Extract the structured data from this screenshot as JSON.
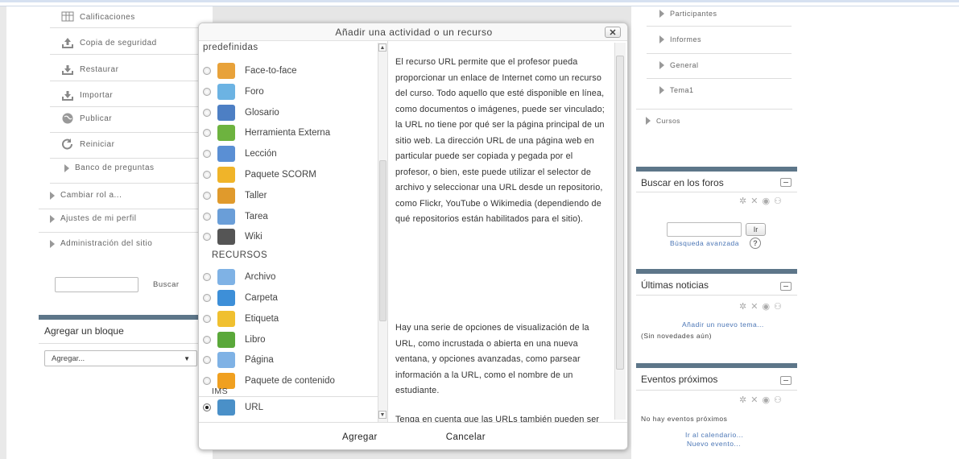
{
  "left_nav": {
    "items": [
      {
        "label": "Calificaciones",
        "icon": "grades-icon"
      },
      {
        "label": "Copia de seguridad",
        "icon": "backup-icon"
      },
      {
        "label": "Restaurar",
        "icon": "restore-icon"
      },
      {
        "label": "Importar",
        "icon": "import-icon"
      },
      {
        "label": "Publicar",
        "icon": "publish-icon"
      },
      {
        "label": "Reiniciar",
        "icon": "reset-icon"
      },
      {
        "label": "Banco de preguntas",
        "icon": "expand-icon"
      }
    ],
    "sections": [
      "Cambiar rol a...",
      "Ajustes de mi perfil",
      "Administración del sitio"
    ],
    "search_button": "Buscar",
    "add_block": {
      "title": "Agregar un bloque",
      "select_value": "Agregar..."
    }
  },
  "modal": {
    "title": "Añadir una actividad o un recurso",
    "close_label": "✕",
    "activities_header_partial": "predefinidas",
    "activities": [
      {
        "label": "Face-to-face",
        "icon": "face-to-face-icon",
        "color": "#e8a23a"
      },
      {
        "label": "Foro",
        "icon": "forum-icon",
        "color": "#6cb3e3"
      },
      {
        "label": "Glosario",
        "icon": "glossary-icon",
        "color": "#4d7fc4"
      },
      {
        "label": "Herramienta Externa",
        "icon": "puzzle-icon",
        "color": "#6db33f"
      },
      {
        "label": "Lección",
        "icon": "lesson-icon",
        "color": "#5a8fd4"
      },
      {
        "label": "Paquete SCORM",
        "icon": "scorm-package-icon",
        "color": "#f0b429"
      },
      {
        "label": "Taller",
        "icon": "workshop-icon",
        "color": "#e09a2c"
      },
      {
        "label": "Tarea",
        "icon": "assignment-icon",
        "color": "#6a9ed8"
      },
      {
        "label": "Wiki",
        "icon": "wiki-icon",
        "color": "#555555"
      }
    ],
    "resources_header": "RECURSOS",
    "resources": [
      {
        "label": "Archivo",
        "icon": "file-icon",
        "color": "#7fb2e5"
      },
      {
        "label": "Carpeta",
        "icon": "folder-icon",
        "color": "#3d8fd8"
      },
      {
        "label": "Etiqueta",
        "icon": "label-icon",
        "color": "#f0c030"
      },
      {
        "label": "Libro",
        "icon": "book-icon",
        "color": "#5aa83a"
      },
      {
        "label": "Página",
        "icon": "page-icon",
        "color": "#7fb2e5"
      },
      {
        "label": "Paquete de contenido",
        "label_wrap": "IMS",
        "icon": "ims-package-icon",
        "color": "#f0a020"
      },
      {
        "label": "URL",
        "icon": "url-icon",
        "color": "#4a90c8",
        "selected": true
      }
    ],
    "description": [
      "El recurso URL permite que el profesor pueda proporcionar un enlace de Internet como un recurso del curso. Todo aquello que esté disponible en línea, como documentos o imágenes, puede ser vinculado; la URL no tiene por qué ser la página principal de un sitio web. La dirección URL de una página web en particular puede ser copiada y pegada por el profesor, o bien, este puede utilizar el selector de archivo y seleccionar una URL desde un repositorio, como Flickr, YouTube o Wikimedia (dependiendo de qué repositorios están habilitados para el sitio).",
      "Hay una serie de opciones de visualización de la URL, como incrustada o abierta en una nueva ventana, y opciones avanzadas, como parsear información a la URL, como el nombre de un estudiante.",
      "Tenga en cuenta que las URLs también pueden ser añadidas en otros recursos o"
    ],
    "add_button": "Agregar",
    "cancel_button": "Cancelar"
  },
  "right_nav": {
    "items": [
      "Participantes",
      "Informes",
      "General",
      "Tema1"
    ],
    "courses": "Cursos"
  },
  "blocks": {
    "forum_search": {
      "title": "Buscar en los foros",
      "go_button": "Ir",
      "advanced": "Búsqueda avanzada"
    },
    "news": {
      "title": "Últimas noticias",
      "add_topic": "Añadir un nuevo tema...",
      "empty": "(Sin novedades aún)"
    },
    "events": {
      "title": "Eventos próximos",
      "empty": "No hay eventos próximos",
      "calendar": "Ir al calendario...",
      "new_event": "Nuevo evento..."
    }
  }
}
